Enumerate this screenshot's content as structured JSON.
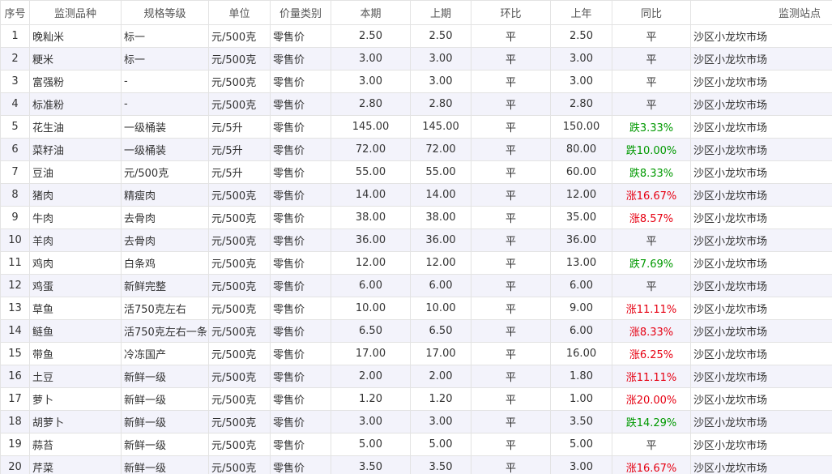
{
  "headers": {
    "index": "序号",
    "item": "监测品种",
    "spec": "规格等级",
    "unit": "单位",
    "price_type": "价量类别",
    "current": "本期",
    "previous": "上期",
    "mom": "环比",
    "last_year": "上年",
    "yoy": "同比",
    "station": "监测站点"
  },
  "colors": {
    "header_current": "#e60012",
    "rise": "#e60012",
    "fall": "#009900",
    "row_alt": "#f3f3fb",
    "border": "#e3e3e3"
  },
  "rows": [
    {
      "index": "1",
      "item": "晚籼米",
      "spec": "标一",
      "unit": "元/500克",
      "price_type": "零售价",
      "current": "2.50",
      "previous": "2.50",
      "mom": "平",
      "last_year": "2.50",
      "yoy": "平",
      "yoy_trend": "flat",
      "station": "沙区小龙坎市场"
    },
    {
      "index": "2",
      "item": "粳米",
      "spec": "标一",
      "unit": "元/500克",
      "price_type": "零售价",
      "current": "3.00",
      "previous": "3.00",
      "mom": "平",
      "last_year": "3.00",
      "yoy": "平",
      "yoy_trend": "flat",
      "station": "沙区小龙坎市场"
    },
    {
      "index": "3",
      "item": "富强粉",
      "spec": "-",
      "unit": "元/500克",
      "price_type": "零售价",
      "current": "3.00",
      "previous": "3.00",
      "mom": "平",
      "last_year": "3.00",
      "yoy": "平",
      "yoy_trend": "flat",
      "station": "沙区小龙坎市场"
    },
    {
      "index": "4",
      "item": "标准粉",
      "spec": "-",
      "unit": "元/500克",
      "price_type": "零售价",
      "current": "2.80",
      "previous": "2.80",
      "mom": "平",
      "last_year": "2.80",
      "yoy": "平",
      "yoy_trend": "flat",
      "station": "沙区小龙坎市场"
    },
    {
      "index": "5",
      "item": "花生油",
      "spec": "一级桶装",
      "unit": "元/5升",
      "price_type": "零售价",
      "current": "145.00",
      "previous": "145.00",
      "mom": "平",
      "last_year": "150.00",
      "yoy": "跌3.33%",
      "yoy_trend": "down",
      "station": "沙区小龙坎市场"
    },
    {
      "index": "6",
      "item": "菜籽油",
      "spec": "一级桶装",
      "unit": "元/5升",
      "price_type": "零售价",
      "current": "72.00",
      "previous": "72.00",
      "mom": "平",
      "last_year": "80.00",
      "yoy": "跌10.00%",
      "yoy_trend": "down",
      "station": "沙区小龙坎市场"
    },
    {
      "index": "7",
      "item": "豆油",
      "spec": "元/500克",
      "unit": "元/5升",
      "price_type": "零售价",
      "current": "55.00",
      "previous": "55.00",
      "mom": "平",
      "last_year": "60.00",
      "yoy": "跌8.33%",
      "yoy_trend": "down",
      "station": "沙区小龙坎市场"
    },
    {
      "index": "8",
      "item": "猪肉",
      "spec": "精瘦肉",
      "unit": "元/500克",
      "price_type": "零售价",
      "current": "14.00",
      "previous": "14.00",
      "mom": "平",
      "last_year": "12.00",
      "yoy": "涨16.67%",
      "yoy_trend": "up",
      "station": "沙区小龙坎市场"
    },
    {
      "index": "9",
      "item": "牛肉",
      "spec": "去骨肉",
      "unit": "元/500克",
      "price_type": "零售价",
      "current": "38.00",
      "previous": "38.00",
      "mom": "平",
      "last_year": "35.00",
      "yoy": "涨8.57%",
      "yoy_trend": "up",
      "station": "沙区小龙坎市场"
    },
    {
      "index": "10",
      "item": "羊肉",
      "spec": "去骨肉",
      "unit": "元/500克",
      "price_type": "零售价",
      "current": "36.00",
      "previous": "36.00",
      "mom": "平",
      "last_year": "36.00",
      "yoy": "平",
      "yoy_trend": "flat",
      "station": "沙区小龙坎市场"
    },
    {
      "index": "11",
      "item": "鸡肉",
      "spec": "白条鸡",
      "unit": "元/500克",
      "price_type": "零售价",
      "current": "12.00",
      "previous": "12.00",
      "mom": "平",
      "last_year": "13.00",
      "yoy": "跌7.69%",
      "yoy_trend": "down",
      "station": "沙区小龙坎市场"
    },
    {
      "index": "12",
      "item": "鸡蛋",
      "spec": "新鲜完整",
      "unit": "元/500克",
      "price_type": "零售价",
      "current": "6.00",
      "previous": "6.00",
      "mom": "平",
      "last_year": "6.00",
      "yoy": "平",
      "yoy_trend": "flat",
      "station": "沙区小龙坎市场"
    },
    {
      "index": "13",
      "item": "草鱼",
      "spec": "活750克左右",
      "unit": "元/500克",
      "price_type": "零售价",
      "current": "10.00",
      "previous": "10.00",
      "mom": "平",
      "last_year": "9.00",
      "yoy": "涨11.11%",
      "yoy_trend": "up",
      "station": "沙区小龙坎市场"
    },
    {
      "index": "14",
      "item": "鲢鱼",
      "spec": "活750克左右一条",
      "unit": "元/500克",
      "price_type": "零售价",
      "current": "6.50",
      "previous": "6.50",
      "mom": "平",
      "last_year": "6.00",
      "yoy": "涨8.33%",
      "yoy_trend": "up",
      "station": "沙区小龙坎市场"
    },
    {
      "index": "15",
      "item": "带鱼",
      "spec": "冷冻国产",
      "unit": "元/500克",
      "price_type": "零售价",
      "current": "17.00",
      "previous": "17.00",
      "mom": "平",
      "last_year": "16.00",
      "yoy": "涨6.25%",
      "yoy_trend": "up",
      "station": "沙区小龙坎市场"
    },
    {
      "index": "16",
      "item": "土豆",
      "spec": "新鲜一级",
      "unit": "元/500克",
      "price_type": "零售价",
      "current": "2.00",
      "previous": "2.00",
      "mom": "平",
      "last_year": "1.80",
      "yoy": "涨11.11%",
      "yoy_trend": "up",
      "station": "沙区小龙坎市场"
    },
    {
      "index": "17",
      "item": "萝卜",
      "spec": "新鲜一级",
      "unit": "元/500克",
      "price_type": "零售价",
      "current": "1.20",
      "previous": "1.20",
      "mom": "平",
      "last_year": "1.00",
      "yoy": "涨20.00%",
      "yoy_trend": "up",
      "station": "沙区小龙坎市场"
    },
    {
      "index": "18",
      "item": "胡萝卜",
      "spec": "新鲜一级",
      "unit": "元/500克",
      "price_type": "零售价",
      "current": "3.00",
      "previous": "3.00",
      "mom": "平",
      "last_year": "3.50",
      "yoy": "跌14.29%",
      "yoy_trend": "down",
      "station": "沙区小龙坎市场"
    },
    {
      "index": "19",
      "item": "蒜苔",
      "spec": "新鲜一级",
      "unit": "元/500克",
      "price_type": "零售价",
      "current": "5.00",
      "previous": "5.00",
      "mom": "平",
      "last_year": "5.00",
      "yoy": "平",
      "yoy_trend": "flat",
      "station": "沙区小龙坎市场"
    },
    {
      "index": "20",
      "item": "芹菜",
      "spec": "新鲜一级",
      "unit": "元/500克",
      "price_type": "零售价",
      "current": "3.50",
      "previous": "3.50",
      "mom": "平",
      "last_year": "3.00",
      "yoy": "涨16.67%",
      "yoy_trend": "up",
      "station": "沙区小龙坎市场"
    }
  ]
}
